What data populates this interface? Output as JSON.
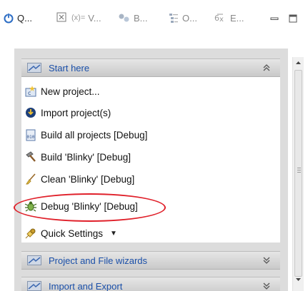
{
  "tabs": [
    {
      "label": "Q...",
      "icon": "power-icon",
      "active": true
    },
    {
      "label": "V...",
      "icon": "variables-icon",
      "active": false
    },
    {
      "label": "B...",
      "icon": "breakpoints-icon",
      "active": false
    },
    {
      "label": "O...",
      "icon": "outline-icon",
      "active": false
    },
    {
      "label": "E...",
      "icon": "expressions-icon",
      "active": false
    }
  ],
  "tab_close_glyph": "⊠",
  "sections": [
    {
      "title": "Start here",
      "expanded": true
    },
    {
      "title": "Project and File wizards",
      "expanded": false
    },
    {
      "title": "Import and Export",
      "expanded": false
    }
  ],
  "items": [
    {
      "label": "New project...",
      "icon": "new-project-icon"
    },
    {
      "label": "Import project(s)",
      "icon": "import-icon"
    },
    {
      "label": "Build all projects [Debug]",
      "icon": "build-all-icon"
    },
    {
      "label": "Build 'Blinky' [Debug]",
      "icon": "hammer-icon"
    },
    {
      "label": "Clean 'Blinky' [Debug]",
      "icon": "broom-icon"
    },
    {
      "label": "Debug 'Blinky' [Debug]",
      "icon": "bug-icon"
    },
    {
      "label": "Quick Settings",
      "icon": "settings-icon"
    }
  ],
  "highlighted_item": "Debug 'Blinky' [Debug]",
  "colors": {
    "section_title": "#1a4fa8",
    "highlight_ring": "#e0202a",
    "panel_bg": "#dcdcdc"
  }
}
